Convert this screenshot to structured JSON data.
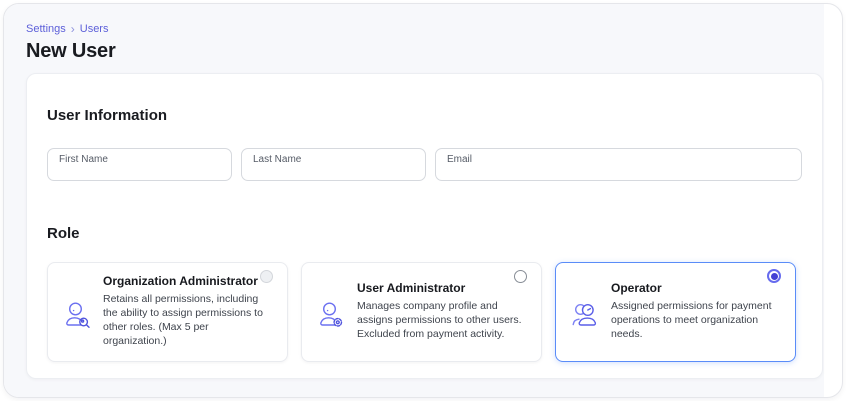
{
  "breadcrumb": {
    "items": [
      {
        "label": "Settings"
      },
      {
        "label": "Users"
      }
    ],
    "separator": "›"
  },
  "page": {
    "title": "New User"
  },
  "user_information": {
    "heading": "User Information",
    "fields": [
      {
        "label": "First Name",
        "value": "",
        "name": "first-name"
      },
      {
        "label": "Last Name",
        "value": "",
        "name": "last-name"
      },
      {
        "label": "Email",
        "value": "",
        "name": "email"
      }
    ]
  },
  "role": {
    "heading": "Role",
    "selected_value": "Operator",
    "options": [
      {
        "title": "Organization Administrator",
        "description": "Retains all permissions, including the ability to assign permissions to other roles. (Max 5 per organization.)",
        "icon": "person-magnifier-icon",
        "selected": false
      },
      {
        "title": "User Administrator",
        "description": "Manages company profile and assigns permissions to other users. Excluded from payment activity.",
        "icon": "person-gear-icon",
        "selected": false
      },
      {
        "title": "Operator",
        "description": "Assigned permissions for payment operations to meet organization needs.",
        "icon": "people-icon",
        "selected": true
      }
    ]
  },
  "colors": {
    "accent": "#5c5fd9",
    "page_background": "#f7f8fb",
    "panel_background": "#ffffff",
    "selected_card_border": "#5a8cf8",
    "radio_selected_ring": "#666bee",
    "radio_selected_fill": "#4340d4",
    "icon_color": "#6b70f0",
    "text_primary": "#191b20",
    "text_secondary": "#3f444d"
  }
}
